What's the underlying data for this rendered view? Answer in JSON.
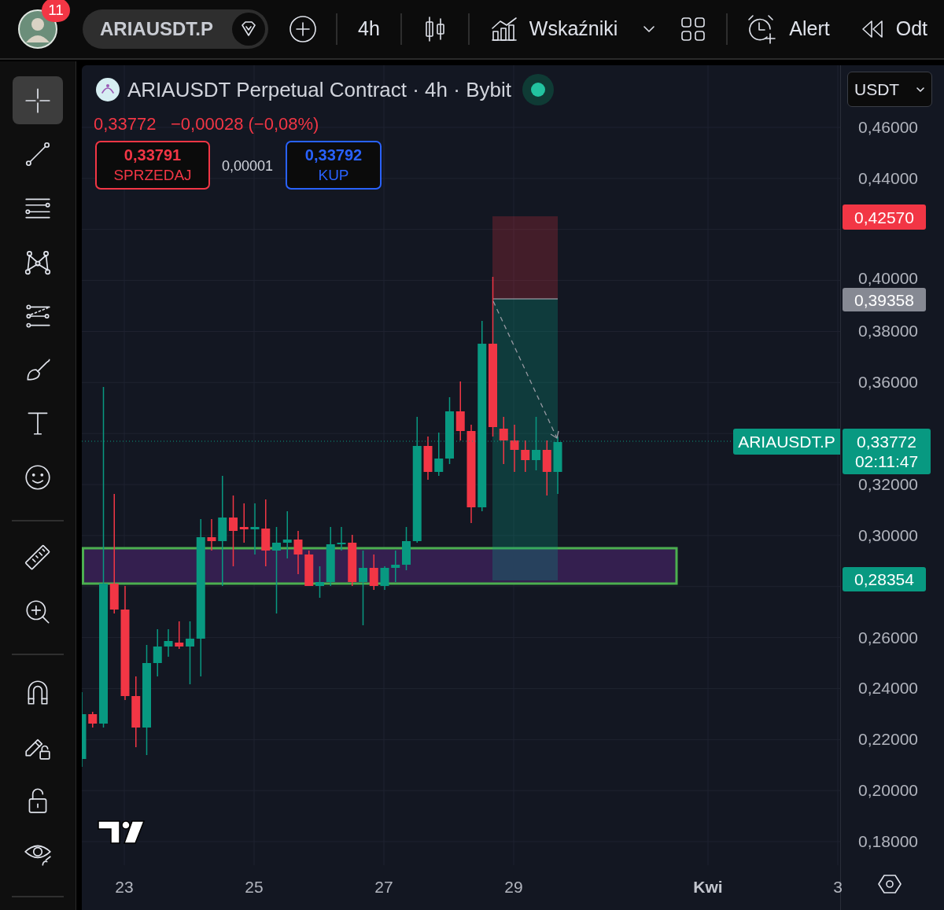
{
  "top_bar": {
    "notification_count": "11",
    "symbol": "ARIAUSDT.P",
    "interval": "4h",
    "indicators_label": "Wskaźniki",
    "alert_label": "Alert",
    "replay_label": "Odt"
  },
  "toolbar": {
    "tools": [
      {
        "kind": "crosshair",
        "selected": true
      },
      {
        "kind": "trend",
        "selected": false
      },
      {
        "kind": "lines",
        "selected": false
      },
      {
        "kind": "pattern",
        "selected": false
      },
      {
        "kind": "forecast",
        "selected": false
      },
      {
        "kind": "brush",
        "selected": false
      },
      {
        "kind": "text",
        "selected": false
      },
      {
        "kind": "emoji",
        "selected": false
      },
      {
        "kind": "divider"
      },
      {
        "kind": "ruler",
        "selected": false
      },
      {
        "kind": "zoom",
        "selected": false
      },
      {
        "kind": "divider"
      },
      {
        "kind": "magnet",
        "selected": false
      },
      {
        "kind": "lockdraw",
        "selected": false
      },
      {
        "kind": "lock",
        "selected": false
      },
      {
        "kind": "eye",
        "selected": false
      },
      {
        "kind": "divider"
      }
    ]
  },
  "legend": {
    "title": "ARIAUSDT Perpetual Contract · 4h · Bybit",
    "last_price": "0,33772",
    "change": "−0,00028 (−0,08%)",
    "sell": {
      "price": "0,33791",
      "label": "SPRZEDAJ"
    },
    "spread": "0,00001",
    "buy": {
      "price": "0,33792",
      "label": "KUP"
    }
  },
  "currency": "USDT",
  "price_axis": {
    "ticks": [
      "0,46000",
      "0,44000",
      "0,40000",
      "0,38000",
      "0,36000",
      "0,32000",
      "0,30000",
      "0,26000",
      "0,24000",
      "0,22000",
      "0,20000",
      "0,18000"
    ],
    "labels": [
      {
        "text": "0,42570",
        "color": "#f23645"
      },
      {
        "text": "0,39358",
        "color": "#868993"
      },
      {
        "text": "0,33772",
        "countdown": "02:11:47",
        "color": "#089981"
      },
      {
        "text": "0,28354",
        "color": "#089981"
      }
    ]
  },
  "symbol_label": "ARIAUSDT.P",
  "time_axis": [
    {
      "text": "23",
      "kind": "day"
    },
    {
      "text": "25",
      "kind": "day"
    },
    {
      "text": "27",
      "kind": "day"
    },
    {
      "text": "29",
      "kind": "day"
    },
    {
      "text": "Kwi",
      "kind": "month"
    },
    {
      "text": "3",
      "kind": "day"
    }
  ]
}
